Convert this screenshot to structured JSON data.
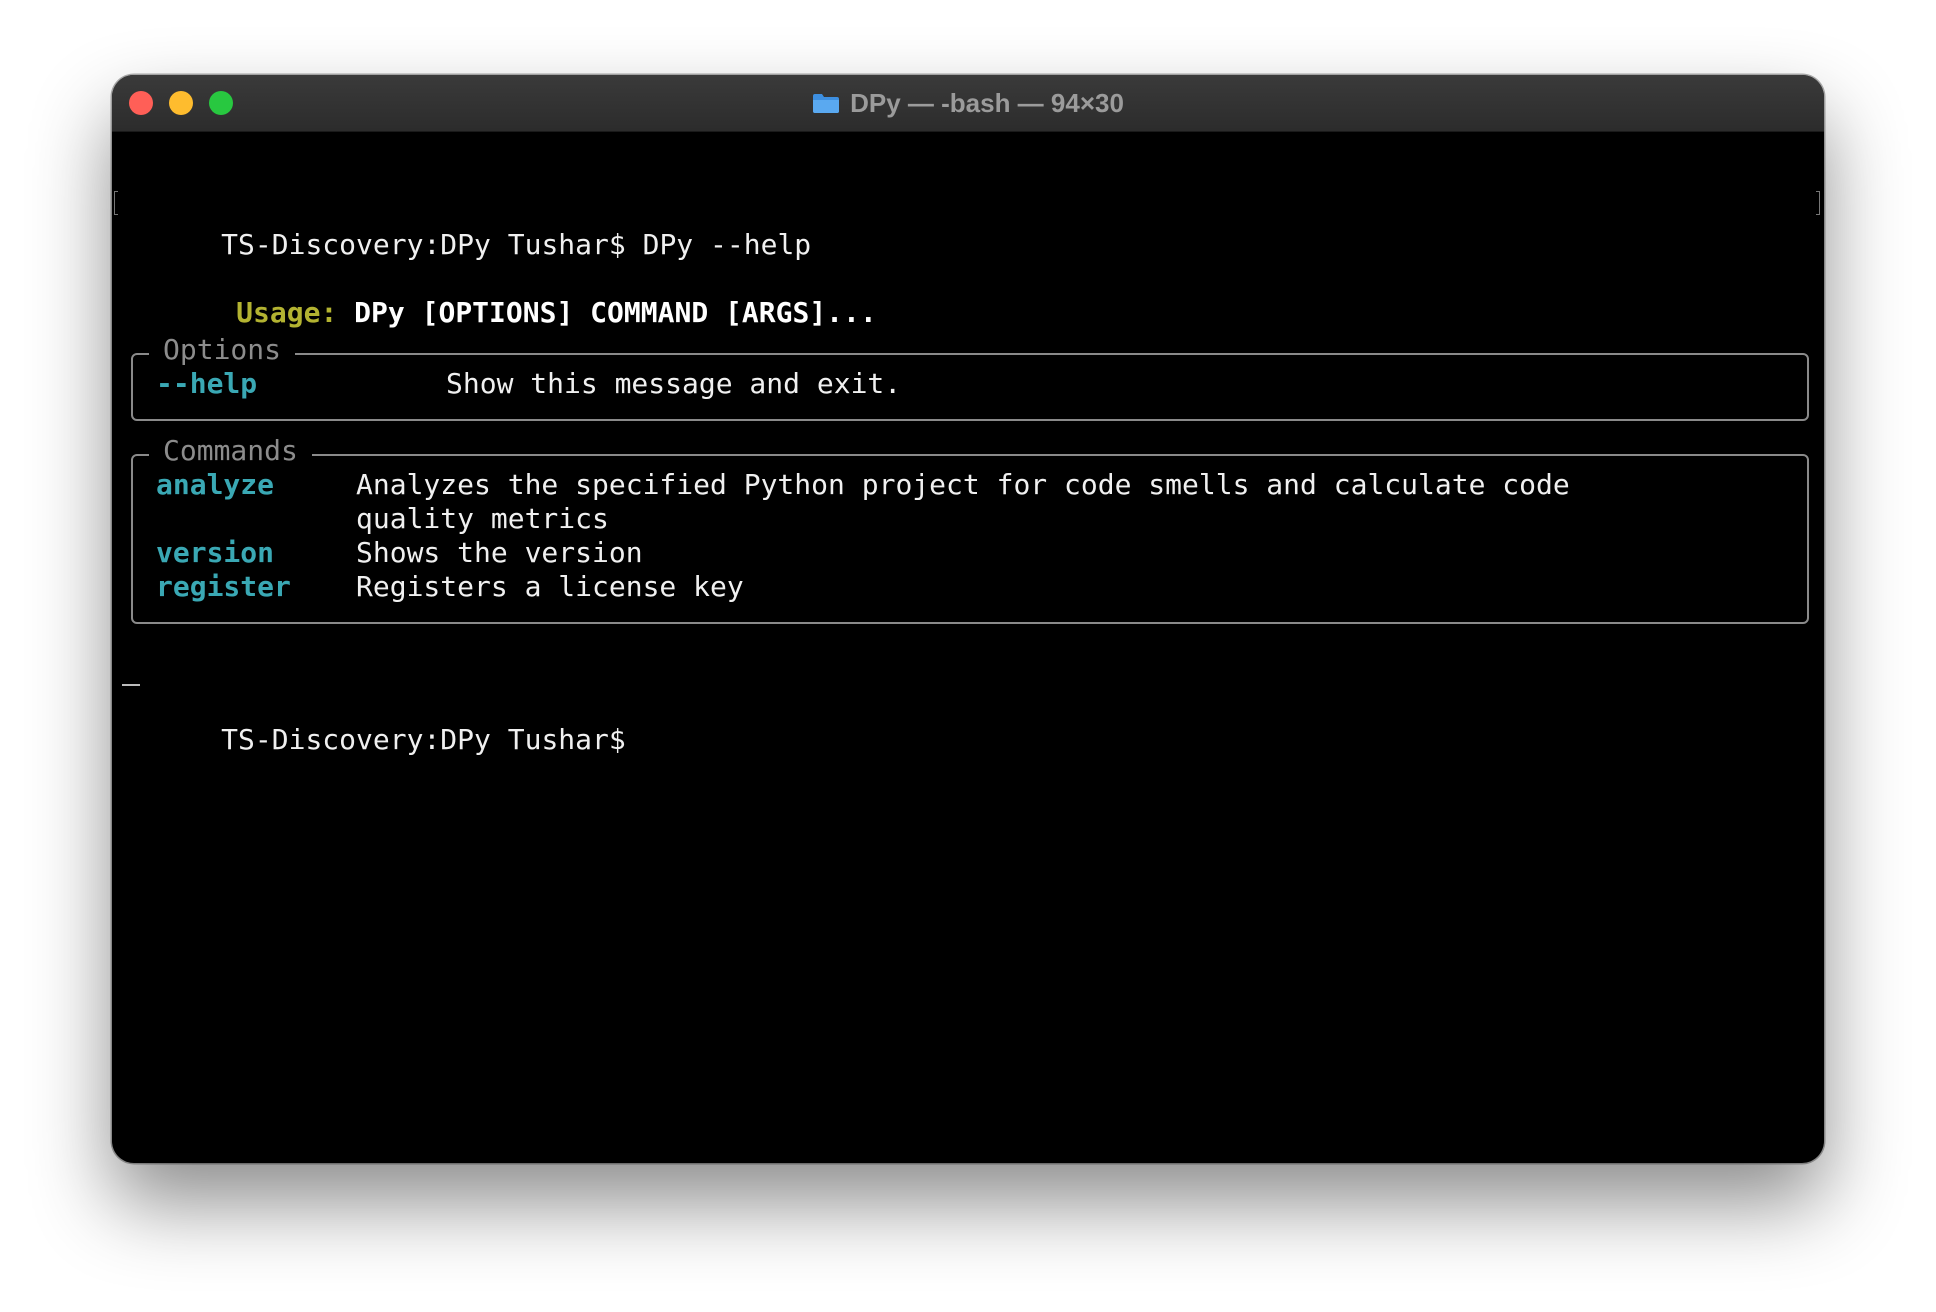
{
  "window": {
    "title": "DPy — -bash — 94×30",
    "folder_icon": "folder-icon",
    "buttons": {
      "close": "close-button",
      "minimize": "minimize-button",
      "zoom": "zoom-button"
    }
  },
  "colors": {
    "usage_label": "#b3b331",
    "option_name": "#3aa8b4",
    "box_border": "#8a8a8a",
    "background": "#000000",
    "text": "#f0f0f0"
  },
  "terminal": {
    "prompt": "TS-Discovery:DPy Tushar$",
    "command": "DPy --help",
    "usage_label": "Usage:",
    "usage_text": "DPy [OPTIONS] COMMAND [ARGS]...",
    "options": {
      "title": "Options",
      "items": [
        {
          "name": "--help",
          "description": "Show this message and exit."
        }
      ]
    },
    "commands": {
      "title": "Commands",
      "items": [
        {
          "name": "analyze",
          "description": "Analyzes the specified Python project for code smells and calculate code",
          "description_cont": "quality metrics"
        },
        {
          "name": "version",
          "description": "Shows the version"
        },
        {
          "name": "register",
          "description": "Registers a license key"
        }
      ]
    },
    "final_prompt": "TS-Discovery:DPy Tushar$"
  }
}
